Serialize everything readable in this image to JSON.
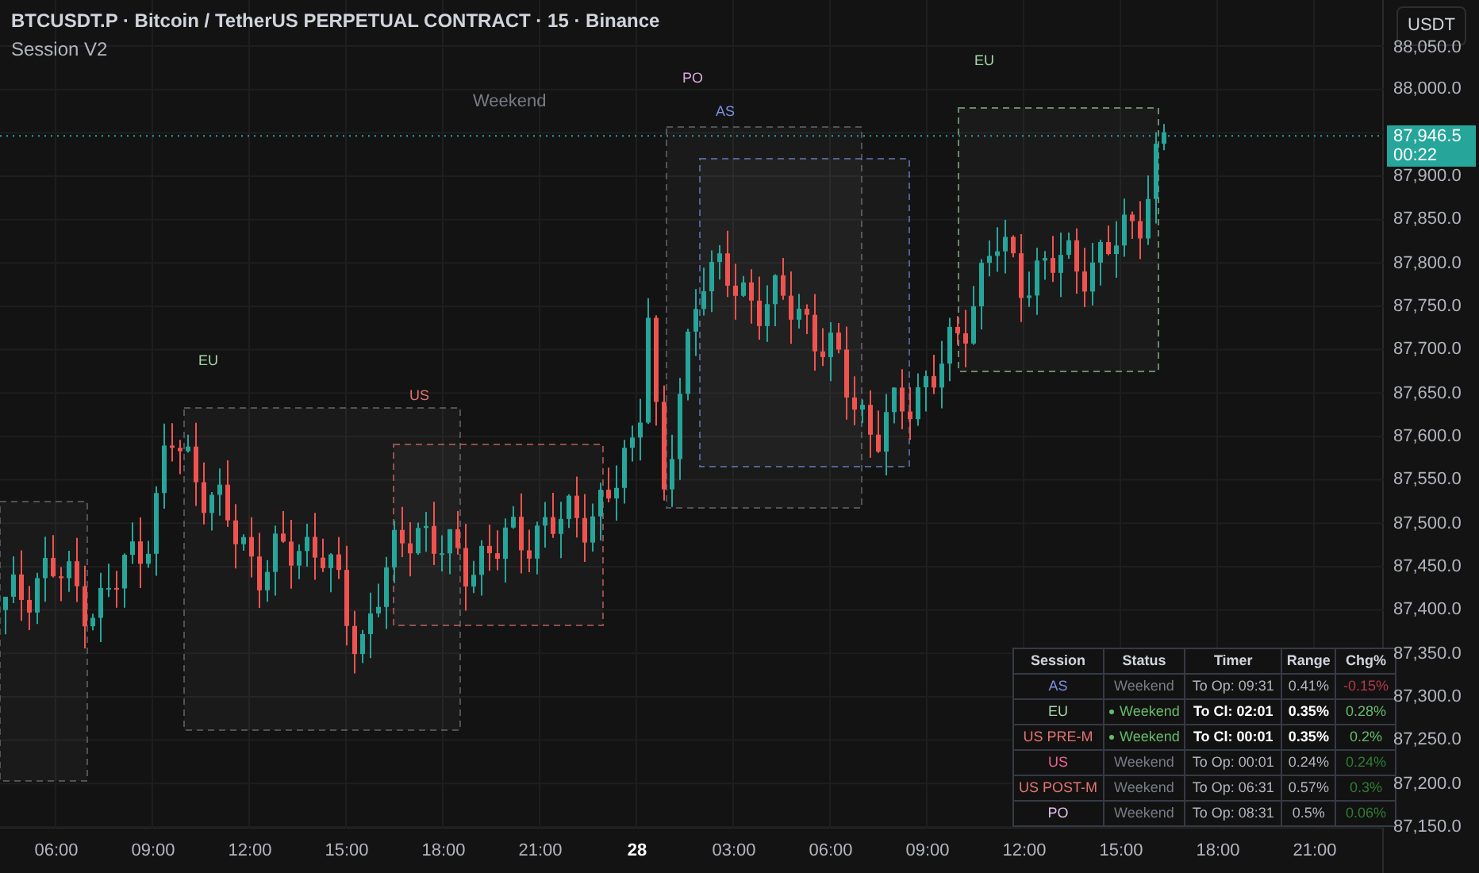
{
  "header": {
    "title": "BTCUSDT.P · Bitcoin / TetherUS PERPETUAL CONTRACT · 15 · Binance",
    "indicator": "Session V2"
  },
  "chart_labels": [
    {
      "text": "Weekend",
      "color": "#787b86"
    },
    {
      "text": "PO",
      "color": "#d8a8dc"
    },
    {
      "text": "AS",
      "color": "#7b8fe0"
    },
    {
      "text": "EU",
      "color": "#a5d6a7"
    },
    {
      "text": "EU",
      "color": "#a5d6a7"
    },
    {
      "text": "US",
      "color": "#e57373"
    }
  ],
  "currency": "USDT",
  "price_axis": [
    "88,050.0",
    "88,000.0",
    "87,900.0",
    "87,850.0",
    "87,800.0",
    "87,750.0",
    "87,700.0",
    "87,650.0",
    "87,600.0",
    "87,550.0",
    "87,500.0",
    "87,450.0",
    "87,400.0",
    "87,350.0",
    "87,300.0",
    "87,250.0",
    "87,200.0",
    "87,150.0"
  ],
  "current_price": {
    "value": "87,946.5",
    "countdown": "00:22"
  },
  "time_axis": [
    {
      "text": "06:00",
      "kind": "time"
    },
    {
      "text": "09:00",
      "kind": "time"
    },
    {
      "text": "12:00",
      "kind": "time"
    },
    {
      "text": "15:00",
      "kind": "time"
    },
    {
      "text": "18:00",
      "kind": "time"
    },
    {
      "text": "21:00",
      "kind": "time"
    },
    {
      "text": "28",
      "kind": "day"
    },
    {
      "text": "03:00",
      "kind": "time"
    },
    {
      "text": "06:00",
      "kind": "time"
    },
    {
      "text": "09:00",
      "kind": "time"
    },
    {
      "text": "12:00",
      "kind": "time"
    },
    {
      "text": "15:00",
      "kind": "time"
    },
    {
      "text": "18:00",
      "kind": "time"
    },
    {
      "text": "21:00",
      "kind": "time"
    }
  ],
  "table": {
    "columns": [
      "Session",
      "Status",
      "Timer",
      "Range",
      "Chg%"
    ],
    "rows": [
      {
        "session": "AS",
        "color": "#7b8fe0",
        "status": "Weekend",
        "active": false,
        "timer": "To Op: 09:31",
        "range": "0.41%",
        "chg": {
          "text": "-0.15%",
          "color": "#b23a48"
        }
      },
      {
        "session": "EU",
        "color": "#a5d6a7",
        "status": "Weekend",
        "active": true,
        "timer": "To Cl: 02:01",
        "range": "0.35%",
        "chg": {
          "text": "0.28%",
          "color": "#66bb6a"
        }
      },
      {
        "session": "US PRE-M",
        "color": "#e57373",
        "status": "Weekend",
        "active": true,
        "timer": "To Cl: 00:01",
        "range": "0.35%",
        "chg": {
          "text": "0.2%",
          "color": "#66bb6a"
        }
      },
      {
        "session": "US",
        "color": "#f06292",
        "status": "Weekend",
        "active": false,
        "timer": "To Op: 00:01",
        "range": "0.24%",
        "chg": {
          "text": "0.24%",
          "color": "#2e7d32"
        }
      },
      {
        "session": "US POST-M",
        "color": "#e57373",
        "status": "Weekend",
        "active": false,
        "timer": "To Op: 06:31",
        "range": "0.57%",
        "chg": {
          "text": "0.3%",
          "color": "#2e7d32"
        }
      },
      {
        "session": "PO",
        "color": "#e1bee7",
        "status": "Weekend",
        "active": false,
        "timer": "To Op: 08:31",
        "range": "0.5%",
        "chg": {
          "text": "0.06%",
          "color": "#2e7d32"
        }
      }
    ]
  }
}
